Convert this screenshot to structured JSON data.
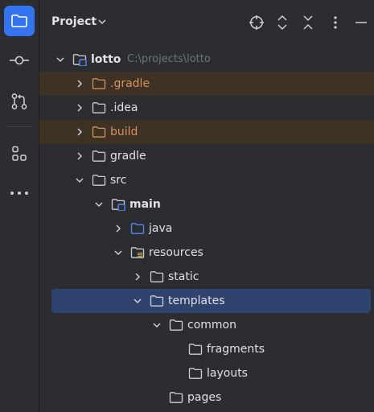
{
  "panel": {
    "title": "Project"
  },
  "tree": [
    {
      "label": "lotto",
      "hint": "C:\\projects\\lotto",
      "level": 0,
      "expanded": true,
      "icon": "module-folder",
      "bold": true
    },
    {
      "label": ".gradle",
      "level": 1,
      "expanded": false,
      "icon": "folder-excluded",
      "excluded": true
    },
    {
      "label": ".idea",
      "level": 1,
      "expanded": false,
      "icon": "folder"
    },
    {
      "label": "build",
      "level": 1,
      "expanded": false,
      "icon": "folder-excluded",
      "excluded": true
    },
    {
      "label": "gradle",
      "level": 1,
      "expanded": false,
      "icon": "folder"
    },
    {
      "label": "src",
      "level": 1,
      "expanded": true,
      "icon": "folder"
    },
    {
      "label": "main",
      "level": 2,
      "expanded": true,
      "icon": "module-folder",
      "bold": true
    },
    {
      "label": "java",
      "level": 3,
      "expanded": false,
      "icon": "source-folder"
    },
    {
      "label": "resources",
      "level": 3,
      "expanded": true,
      "icon": "resources-folder"
    },
    {
      "label": "static",
      "level": 4,
      "expanded": false,
      "icon": "folder"
    },
    {
      "label": "templates",
      "level": 4,
      "expanded": true,
      "icon": "folder",
      "selected": true
    },
    {
      "label": "common",
      "level": 5,
      "expanded": true,
      "icon": "folder"
    },
    {
      "label": "fragments",
      "level": 6,
      "icon": "folder"
    },
    {
      "label": "layouts",
      "level": 6,
      "icon": "folder"
    },
    {
      "label": "pages",
      "level": 5,
      "icon": "folder"
    }
  ]
}
